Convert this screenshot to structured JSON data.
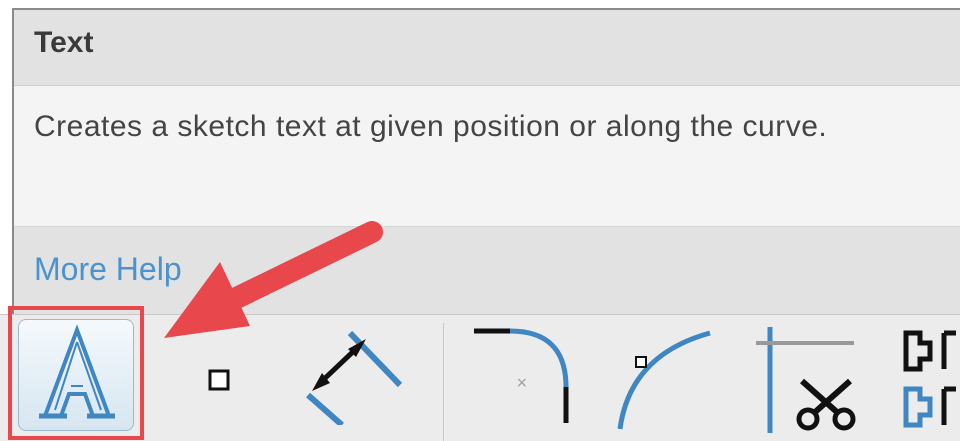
{
  "tooltip": {
    "title": "Text",
    "description": "Creates a sketch text at given position or along the curve.",
    "more_help_label": "More Help"
  },
  "toolbar": {
    "tools": [
      {
        "name": "text",
        "icon": "text-a-icon",
        "active": true
      },
      {
        "name": "point",
        "icon": "point-icon"
      },
      {
        "name": "dimension",
        "icon": "dimension-icon"
      },
      {
        "name": "fillet",
        "icon": "fillet-icon"
      },
      {
        "name": "arc",
        "icon": "arc-icon"
      },
      {
        "name": "trim",
        "icon": "scissors-icon"
      },
      {
        "name": "break",
        "icon": "break-icon"
      }
    ]
  },
  "annotation": {
    "color": "#e8474c",
    "icon": "red-arrow-icon"
  }
}
